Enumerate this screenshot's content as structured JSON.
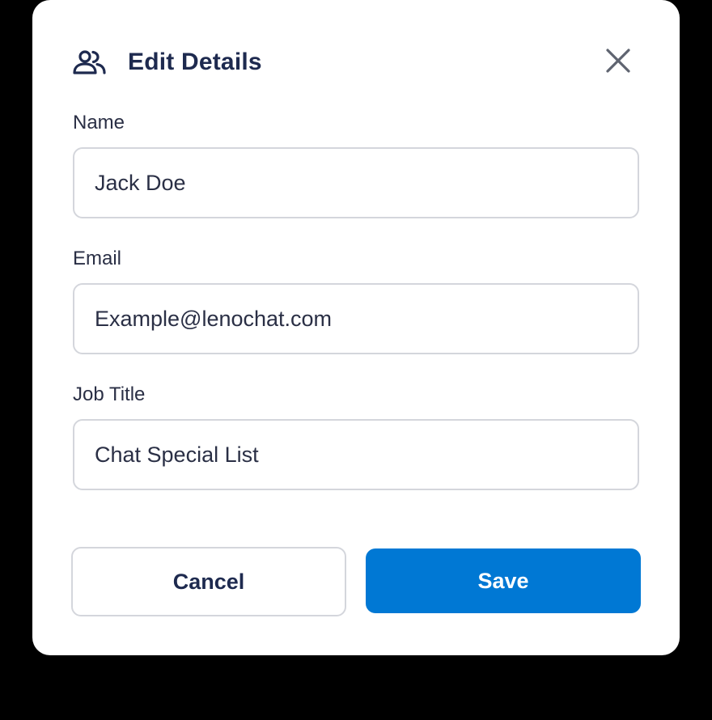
{
  "dialog": {
    "title": "Edit Details",
    "header_icon": "users-icon",
    "close_icon": "close-icon"
  },
  "fields": {
    "name": {
      "label": "Name",
      "value": "Jack Doe"
    },
    "email": {
      "label": "Email",
      "value": "Example@lenochat.com"
    },
    "job_title": {
      "label": "Job Title",
      "value": "Chat Special List"
    }
  },
  "actions": {
    "cancel_label": "Cancel",
    "save_label": "Save"
  },
  "colors": {
    "primary": "#0078d4",
    "title_text": "#1e2a4f",
    "border": "#d4d6dc",
    "backdrop": "#000000"
  }
}
